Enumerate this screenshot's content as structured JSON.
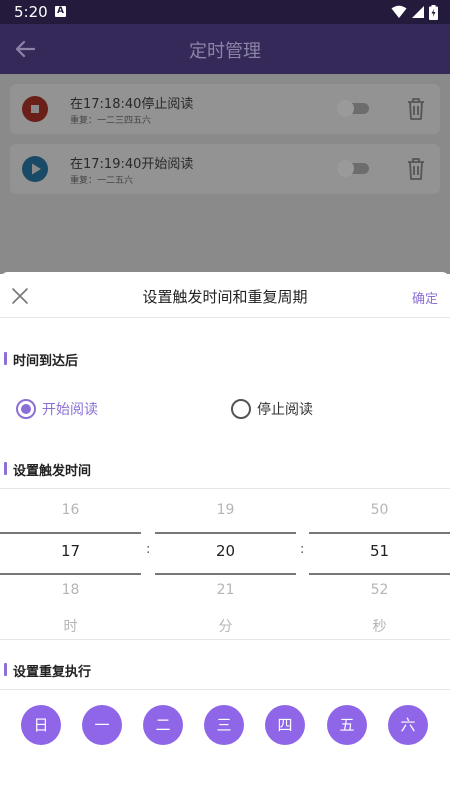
{
  "status_bar": {
    "time": "5:20",
    "badge": "A"
  },
  "app_bar": {
    "title": "定时管理"
  },
  "timers": [
    {
      "title": "在17:18:40停止阅读",
      "repeat": "重复：一二三四五六",
      "state": "stop"
    },
    {
      "title": "在17:19:40开始阅读",
      "repeat": "重复：一二五六",
      "state": "play"
    }
  ],
  "sheet": {
    "title": "设置触发时间和重复周期",
    "confirm": "确定",
    "after_label": "时间到达后",
    "options": [
      {
        "label": "开始阅读",
        "checked": true
      },
      {
        "label": "停止阅读",
        "checked": false
      }
    ],
    "time_label": "设置触发时间",
    "picker": {
      "hour": {
        "prev": "16",
        "current": "17",
        "next": "18",
        "unit": "时"
      },
      "minute": {
        "prev": "19",
        "current": "20",
        "next": "21",
        "unit": "分"
      },
      "second": {
        "prev": "50",
        "current": "51",
        "next": "52",
        "unit": "秒"
      },
      "separator": ":"
    },
    "repeat_label": "设置重复执行",
    "days": [
      "日",
      "一",
      "二",
      "三",
      "四",
      "五",
      "六"
    ]
  },
  "colors": {
    "accent": "#8c6fd6",
    "day_circle": "#8f66e8",
    "app_bar": "#35295a"
  }
}
